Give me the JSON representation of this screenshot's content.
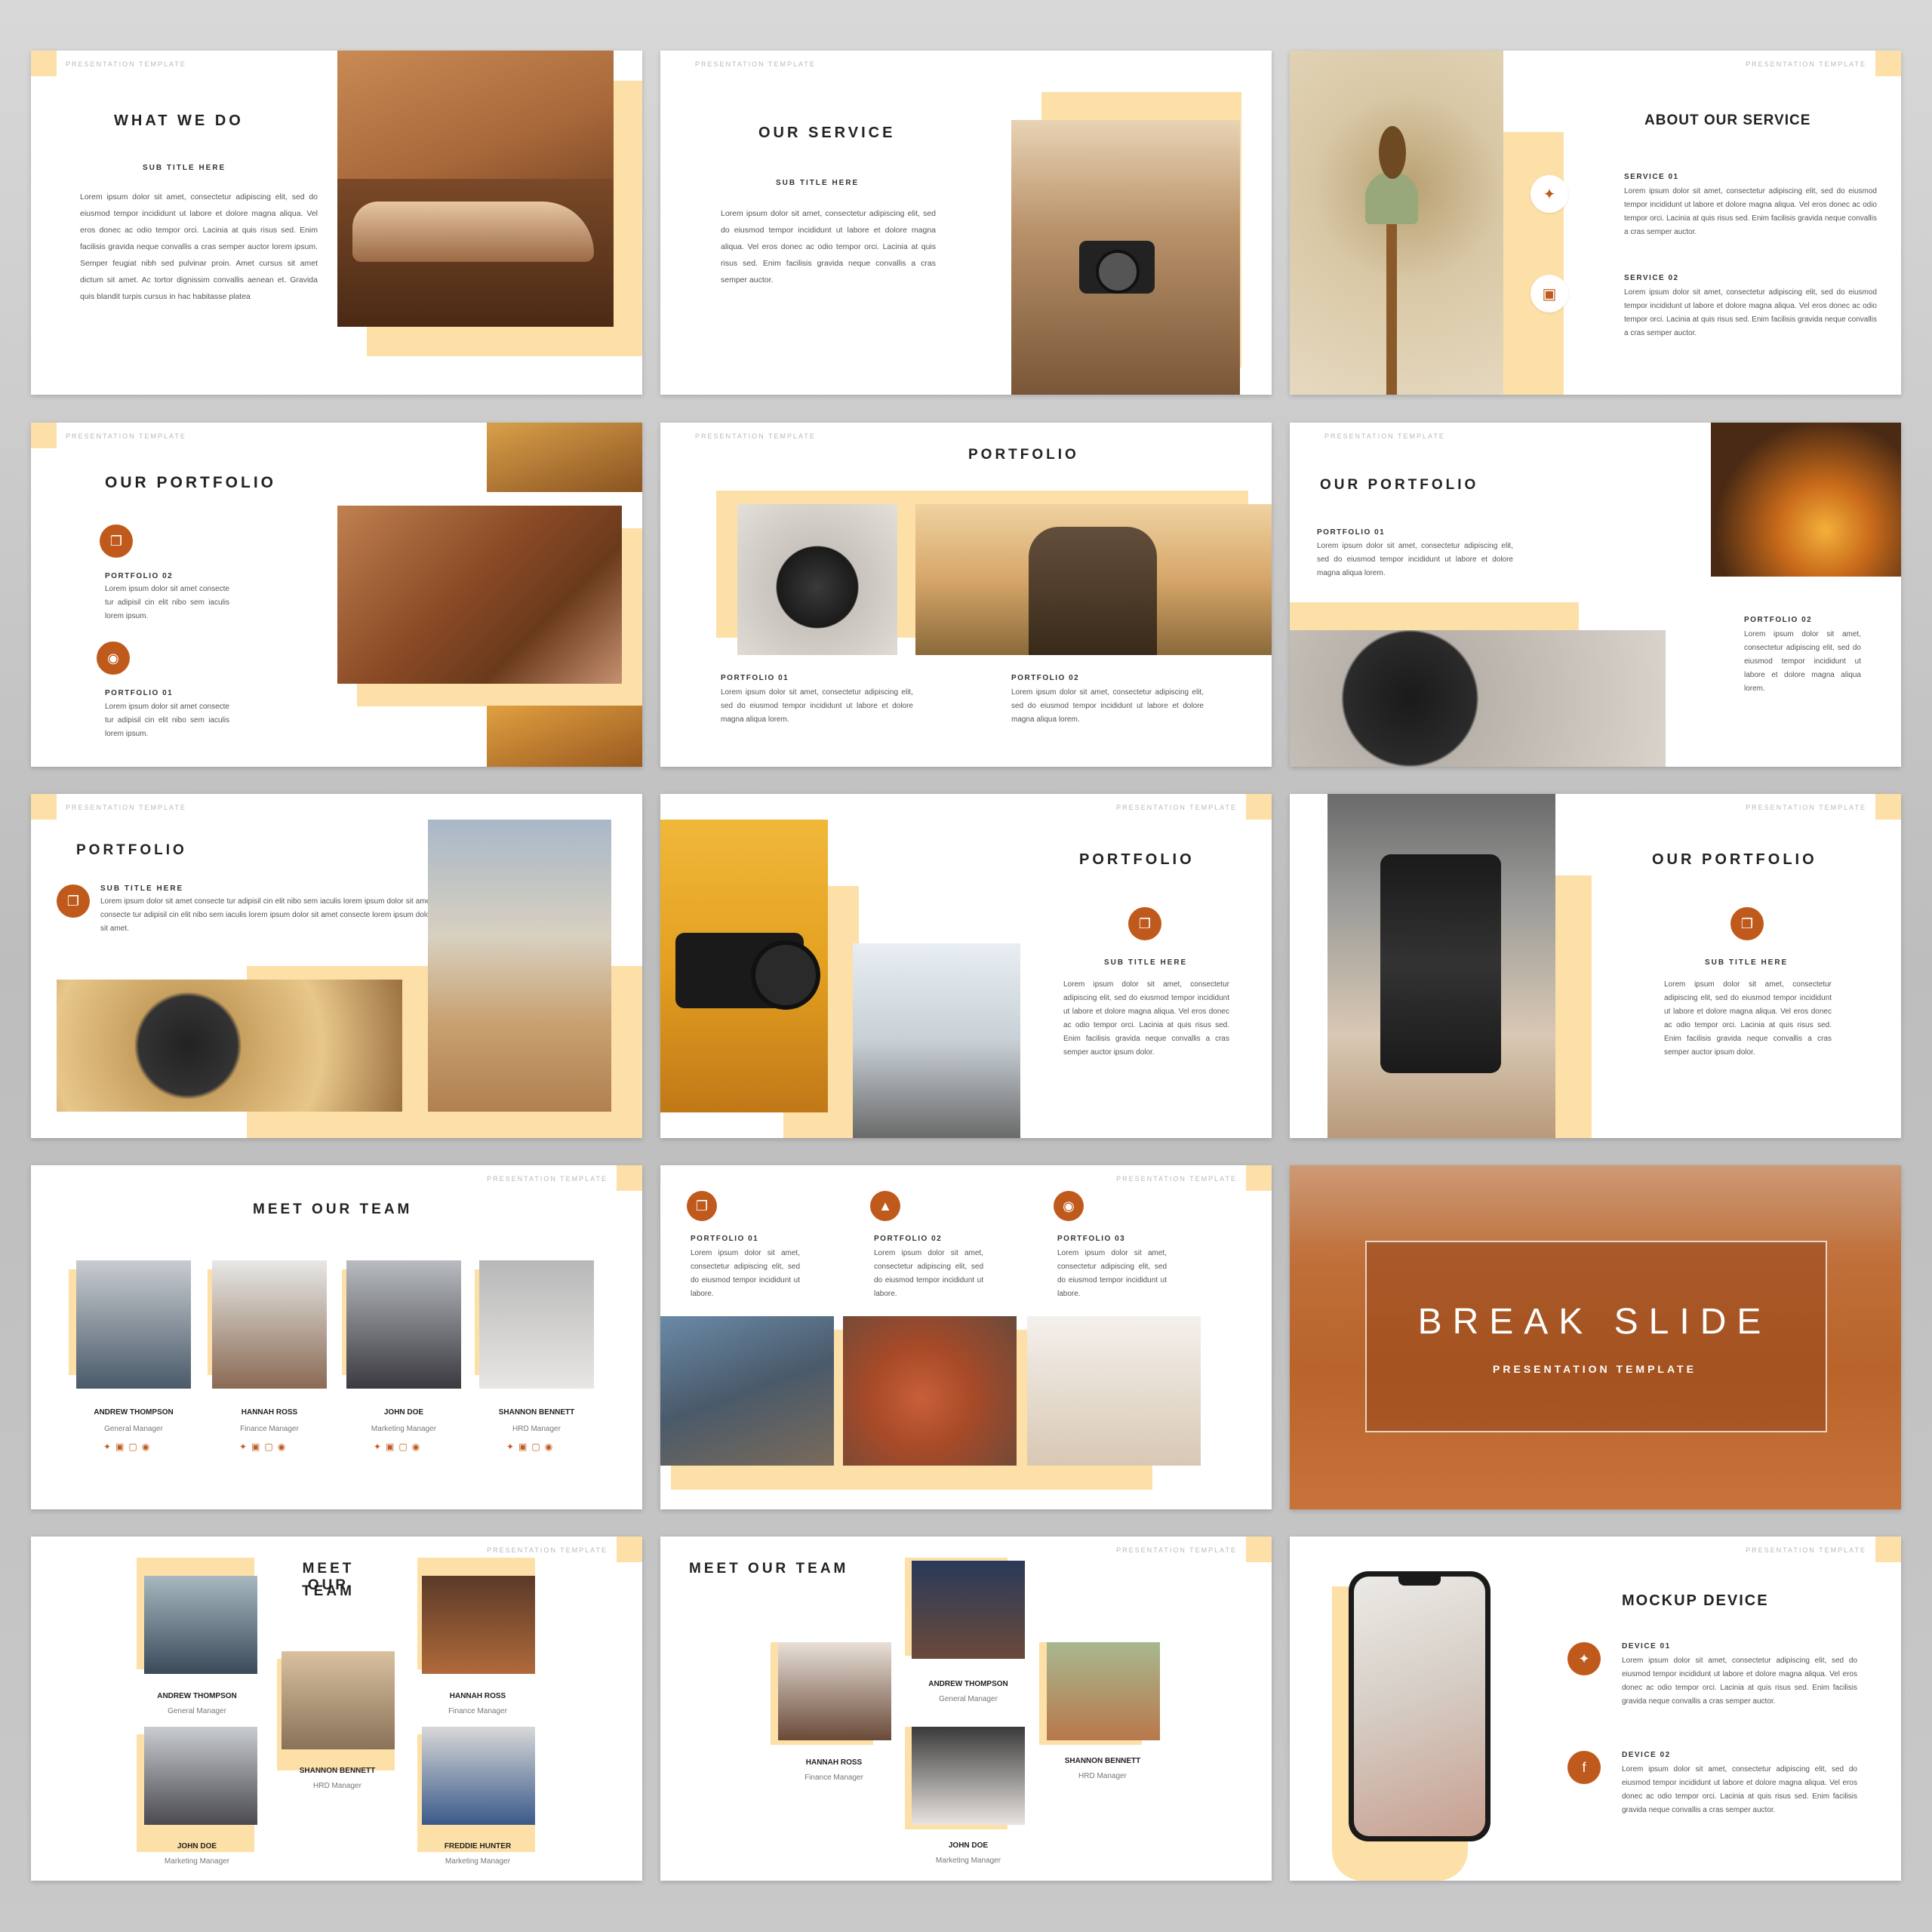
{
  "template_label": "PRESENTATION TEMPLATE",
  "lorem_long": "Lorem ipsum dolor sit amet, consectetur adipiscing elit, sed do eiusmod tempor incididunt ut labore et dolore magna aliqua. Vel eros donec ac odio tempor orci. Lacinia at quis risus sed. Enim facilisis gravida neque convallis a cras semper auctor lorem ipsum. Semper feugiat nibh sed pulvinar proin. Amet cursus sit amet dictum sit amet. Ac tortor dignissim convallis aenean et. Gravida quis blandit turpis cursus in hac habitasse platea",
  "lorem_service": "Lorem ipsum dolor sit amet, consectetur adipiscing elit, sed do eiusmod tempor incididunt ut labore et dolore magna aliqua. Vel eros donec ac odio tempor orci. Lacinia at quis risus sed. Enim facilisis gravida neque convallis a cras semper auctor.",
  "lorem_svc_item": "Lorem ipsum dolor sit amet, consectetur adipiscing elit, sed do eiusmod tempor incididunt ut labore et dolore magna aliqua. Vel eros donec ac odio tempor orci. Lacinia at quis risus sed. Enim facilisis gravida neque convallis a cras semper auctor.",
  "lorem_short": "Lorem ipsum dolor sit amet consecte tur adipisil cin elit nibo sem iaculis lorem ipsum.",
  "lorem_pf": "Lorem ipsum dolor sit amet, consectetur adipiscing elit, sed do eiusmod tempor incididunt ut labore et dolore magna aliqua lorem.",
  "lorem_pf2": "Lorem ipsum dolor sit amet, consectetur adipiscing elit, sed do eiusmod tempor incididunt ut labore et dolore magna aliqua lorem.",
  "lorem_3line": "Lorem ipsum dolor sit amet consecte tur adipisil cin elit nibo sem iaculis lorem ipsum dolor sit amet consecte tur adipisil cin elit nibo sem iaculis lorem ipsum dolor sit amet consecte lorem ipsum dolor sit amet.",
  "lorem_col": "Lorem ipsum dolor sit amet, consectetur adipiscing elit, sed do eiusmod tempor incididunt ut labore et dolore magna aliqua. Vel eros donec ac odio tempor orci. Lacinia at quis risus sed. Enim facilisis gravida neque convallis a cras semper auctor ipsum dolor.",
  "lorem_tiny": "Lorem ipsum dolor sit amet, consectetur adipiscing elit, sed do eiusmod tempor incididunt ut labore.",
  "lorem_device": "Lorem ipsum dolor sit amet, consectetur adipiscing elit, sed do eiusmod tempor incididunt ut labore et dolore magna aliqua. Vel eros donec ac odio tempor orci. Lacinia at quis risus sed. Enim facilisis gravida neque convallis a cras semper auctor.",
  "s1": {
    "title": "WHAT WE DO",
    "sub": "SUB TITLE HERE"
  },
  "s2": {
    "title": "OUR SERVICE",
    "sub": "SUB TITLE HERE"
  },
  "s3": {
    "title": "ABOUT OUR SERVICE",
    "svc1": "SERVICE 01",
    "svc2": "SERVICE 02"
  },
  "s4": {
    "title": "OUR PORTFOLIO",
    "p2": "PORTFOLIO 02",
    "p1": "PORTFOLIO 01"
  },
  "s5": {
    "title": "PORTFOLIO",
    "p1": "PORTFOLIO 01",
    "p2": "PORTFOLIO 02"
  },
  "s6": {
    "title": "OUR PORTFOLIO",
    "p1": "PORTFOLIO 01",
    "p2": "PORTFOLIO 02"
  },
  "s7": {
    "title": "PORTFOLIO",
    "sub": "SUB TITLE HERE"
  },
  "s8": {
    "title": "PORTFOLIO",
    "sub": "SUB TITLE HERE"
  },
  "s9": {
    "title": "OUR PORTFOLIO",
    "sub": "SUB TITLE HERE"
  },
  "s10": {
    "title": "MEET OUR TEAM",
    "members": [
      {
        "name": "ANDREW THOMPSON",
        "role": "General Manager"
      },
      {
        "name": "HANNAH ROSS",
        "role": "Finance Manager"
      },
      {
        "name": "JOHN DOE",
        "role": "Marketing Manager"
      },
      {
        "name": "SHANNON BENNETT",
        "role": "HRD Manager"
      }
    ]
  },
  "s11": {
    "p1": "PORTFOLIO 01",
    "p2": "PORTFOLIO 02",
    "p3": "PORTFOLIO 03"
  },
  "s12": {
    "title": "BREAK SLIDE",
    "sub": "PRESENTATION TEMPLATE"
  },
  "s13": {
    "title_1": "MEET OUR",
    "title_2": "TEAM",
    "members": [
      {
        "name": "ANDREW THOMPSON",
        "role": "General Manager"
      },
      {
        "name": "HANNAH ROSS",
        "role": "Finance Manager"
      },
      {
        "name": "SHANNON BENNETT",
        "role": "HRD Manager"
      },
      {
        "name": "JOHN DOE",
        "role": "Marketing Manager"
      },
      {
        "name": "FREDDIE HUNTER",
        "role": "Marketing Manager"
      }
    ]
  },
  "s14": {
    "title": "MEET OUR TEAM",
    "members": [
      {
        "name": "ANDREW THOMPSON",
        "role": "General Manager"
      },
      {
        "name": "HANNAH ROSS",
        "role": "Finance Manager"
      },
      {
        "name": "SHANNON BENNETT",
        "role": "HRD Manager"
      },
      {
        "name": "JOHN DOE",
        "role": "Marketing Manager"
      }
    ]
  },
  "s15": {
    "title": "MOCKUP DEVICE",
    "d1": "DEVICE 01",
    "d2": "DEVICE 02"
  },
  "icons": {
    "twitter": "twitter-icon",
    "instagram": "instagram-icon",
    "copy": "copy-icon",
    "camera": "camera-icon",
    "image": "image-icon",
    "facebook": "facebook-icon"
  },
  "colors": {
    "accent": "#bf5a1c",
    "peach": "#fde0a8",
    "background": "#c8c8c8"
  }
}
